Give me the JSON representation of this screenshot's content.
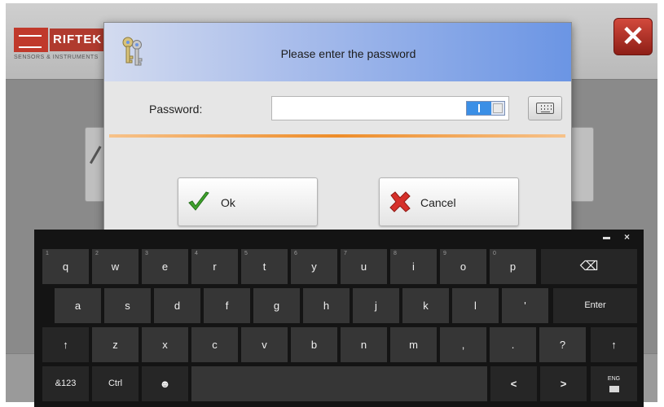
{
  "app": {
    "logo": {
      "brand": "RIFTEK",
      "tagline": "SENSORS & INSTRUMENTS"
    },
    "close_icon": "close-icon",
    "accent_color": "#c0392b"
  },
  "dialog": {
    "title": "Please enter the password",
    "title_icon": "keys-icon",
    "password_label": "Password:",
    "password_value": "",
    "toggle_state": "on",
    "keyboard_icon": "keyboard-icon",
    "separator_color": "#ee8d2a",
    "ok_label": "Ok",
    "ok_icon": "checkmark-icon",
    "cancel_label": "Cancel",
    "cancel_icon": "red-x-icon"
  },
  "keyboard": {
    "controls": {
      "minimize_icon": "minimize-icon",
      "close_glyph": "×"
    },
    "row1": [
      {
        "label": "q",
        "hint": "1"
      },
      {
        "label": "w",
        "hint": "2"
      },
      {
        "label": "e",
        "hint": "3"
      },
      {
        "label": "r",
        "hint": "4"
      },
      {
        "label": "t",
        "hint": "5"
      },
      {
        "label": "y",
        "hint": "6"
      },
      {
        "label": "u",
        "hint": "7"
      },
      {
        "label": "i",
        "hint": "8"
      },
      {
        "label": "o",
        "hint": "9"
      },
      {
        "label": "p",
        "hint": "0"
      },
      {
        "label": "⌫",
        "hint": ""
      }
    ],
    "row2": [
      {
        "label": "a"
      },
      {
        "label": "s"
      },
      {
        "label": "d"
      },
      {
        "label": "f"
      },
      {
        "label": "g"
      },
      {
        "label": "h"
      },
      {
        "label": "j"
      },
      {
        "label": "k"
      },
      {
        "label": "l"
      },
      {
        "label": "'"
      },
      {
        "label": "Enter"
      }
    ],
    "row3": [
      {
        "label": "↑"
      },
      {
        "label": "z"
      },
      {
        "label": "x"
      },
      {
        "label": "c"
      },
      {
        "label": "v"
      },
      {
        "label": "b"
      },
      {
        "label": "n"
      },
      {
        "label": "m"
      },
      {
        "label": ","
      },
      {
        "label": "."
      },
      {
        "label": "?"
      },
      {
        "label": "↑"
      }
    ],
    "row4": [
      {
        "label": "&123"
      },
      {
        "label": "Ctrl"
      },
      {
        "label": "☻"
      },
      {
        "label": ""
      },
      {
        "label": "<"
      },
      {
        "label": ">"
      },
      {
        "label": "ENG"
      }
    ]
  }
}
